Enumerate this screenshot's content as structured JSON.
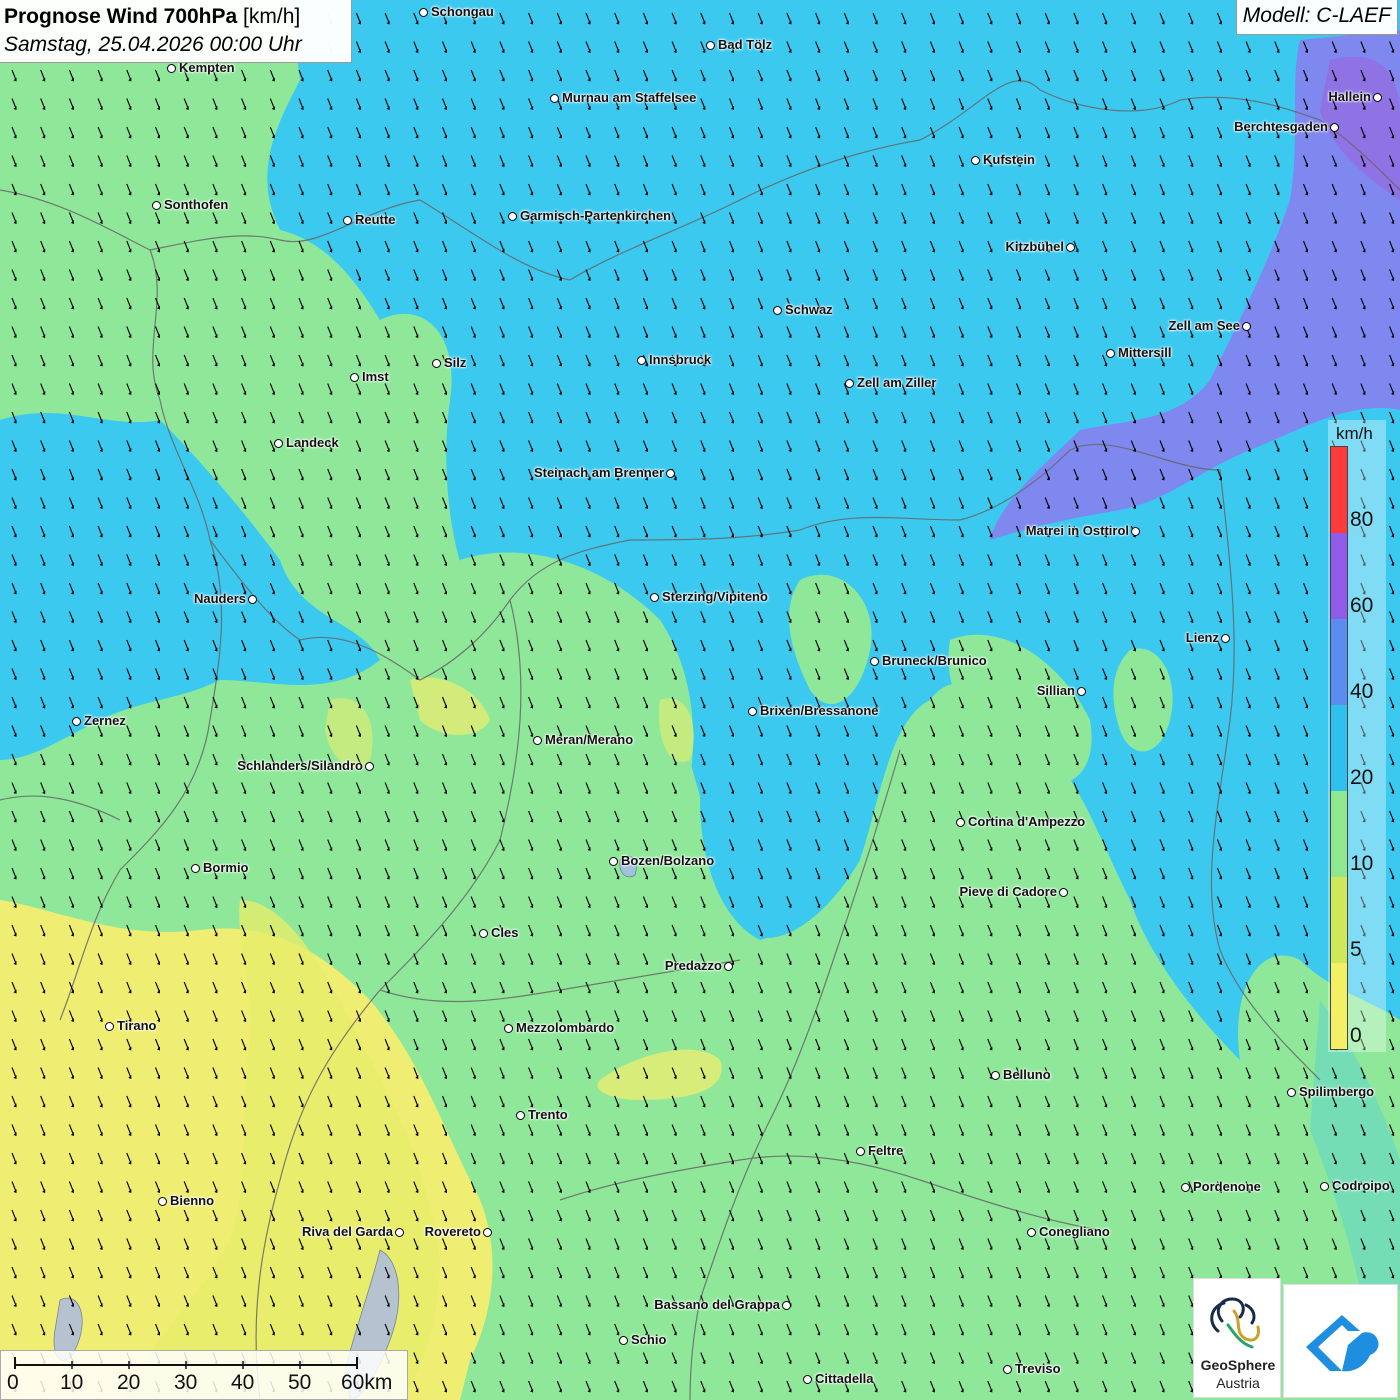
{
  "title": {
    "main": "Prognose Wind 700hPa",
    "unit": "[km/h]",
    "datetime": "Samstag, 25.04.2026 00:00 Uhr"
  },
  "model": "Modell: C-LAEF",
  "legend": {
    "unit": "km/h",
    "labels": [
      "80",
      "60",
      "40",
      "20",
      "10",
      "5",
      "0"
    ],
    "colors": [
      "#ff3a3a",
      "#8f5be8",
      "#5b8cef",
      "#2fc0ee",
      "#8fe88f",
      "#cde85a",
      "#f3f066"
    ]
  },
  "scalebar": {
    "ticks": [
      "0",
      "10",
      "20",
      "30",
      "40",
      "50",
      "60km"
    ]
  },
  "logo": {
    "left_line1": "GeoSphere",
    "left_line2": "Austria"
  },
  "cities": [
    {
      "name": "Schongau"
    },
    {
      "name": "Bad Tölz"
    },
    {
      "name": "Kempten"
    },
    {
      "name": "Murnau am Staffelsee"
    },
    {
      "name": "Hallein"
    },
    {
      "name": "Berchtesgaden"
    },
    {
      "name": "Kufstein"
    },
    {
      "name": "Sonthofen"
    },
    {
      "name": "Reutte"
    },
    {
      "name": "Garmisch-Partenkirchen"
    },
    {
      "name": "Kitzbühel"
    },
    {
      "name": "Schwaz"
    },
    {
      "name": "Zell am See"
    },
    {
      "name": "Mittersill"
    },
    {
      "name": "Innsbruck"
    },
    {
      "name": "Silz"
    },
    {
      "name": "Imst"
    },
    {
      "name": "Zell am Ziller"
    },
    {
      "name": "Landeck"
    },
    {
      "name": "Steinach am Brenner"
    },
    {
      "name": "Matrei in Osttirol"
    },
    {
      "name": "Nauders"
    },
    {
      "name": "Sterzing/Vipiteno"
    },
    {
      "name": "Lienz"
    },
    {
      "name": "Bruneck/Brunico"
    },
    {
      "name": "Sillian"
    },
    {
      "name": "Zernez"
    },
    {
      "name": "Brixen/Bressanone"
    },
    {
      "name": "Meran/Merano"
    },
    {
      "name": "Schlanders/Silandro"
    },
    {
      "name": "Cortina d'Ampezzo"
    },
    {
      "name": "Bozen/Bolzano"
    },
    {
      "name": "Bormio"
    },
    {
      "name": "Pieve di Cadore"
    },
    {
      "name": "Cles"
    },
    {
      "name": "Predazzo"
    },
    {
      "name": "Tirano"
    },
    {
      "name": "Mezzolombardo"
    },
    {
      "name": "Belluno"
    },
    {
      "name": "Spilimbergo"
    },
    {
      "name": "Trento"
    },
    {
      "name": "Feltre"
    },
    {
      "name": "Pordenone"
    },
    {
      "name": "Codroipo"
    },
    {
      "name": "Bienno"
    },
    {
      "name": "Riva del Garda"
    },
    {
      "name": "Rovereto"
    },
    {
      "name": "Conegliano"
    },
    {
      "name": "Bassano del Grappa"
    },
    {
      "name": "Schio"
    },
    {
      "name": "Treviso"
    },
    {
      "name": "Cittadella"
    }
  ]
}
